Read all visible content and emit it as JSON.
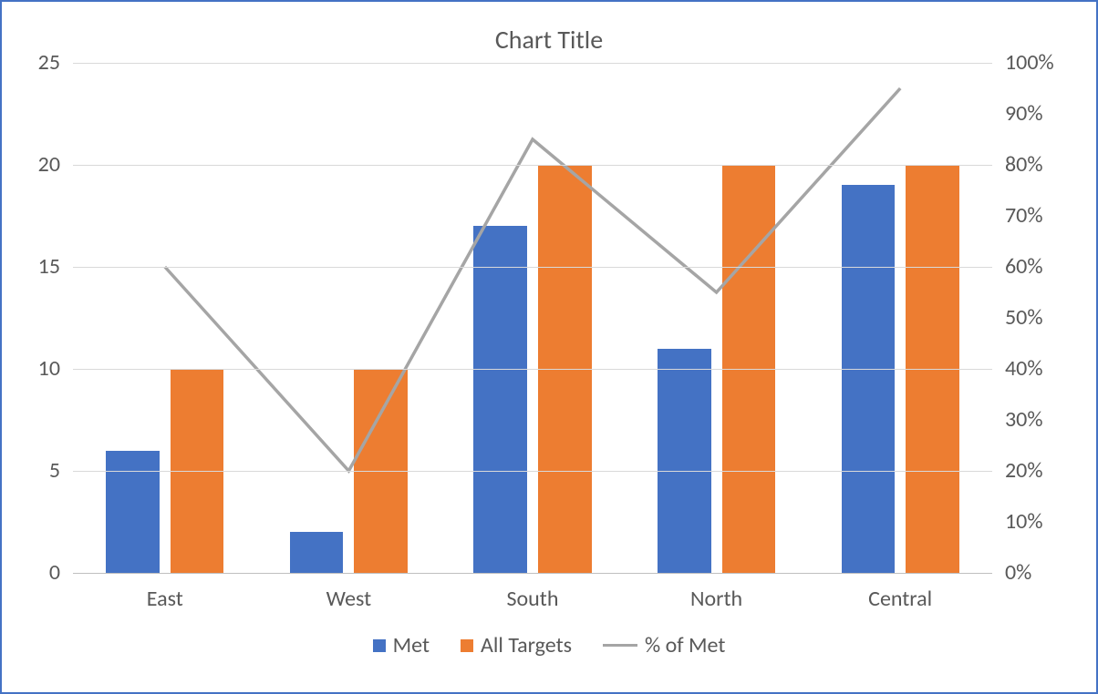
{
  "chart_data": {
    "type": "bar",
    "title": "Chart Title",
    "categories": [
      "East",
      "West",
      "South",
      "North",
      "Central"
    ],
    "series": [
      {
        "name": "Met",
        "kind": "bar",
        "axis": "primary",
        "color": "#4472C4",
        "values": [
          6,
          2,
          17,
          11,
          19
        ]
      },
      {
        "name": "All Targets",
        "kind": "bar",
        "axis": "primary",
        "color": "#ED7D31",
        "values": [
          10,
          10,
          20,
          20,
          20
        ]
      },
      {
        "name": "% of Met",
        "kind": "line",
        "axis": "secondary",
        "color": "#A5A5A5",
        "values": [
          0.6,
          0.2,
          0.85,
          0.55,
          0.95
        ]
      }
    ],
    "primary_axis": {
      "min": 0,
      "max": 25,
      "ticks": [
        0,
        5,
        10,
        15,
        20,
        25
      ]
    },
    "secondary_axis": {
      "min": 0,
      "max": 1.0,
      "format": "percent",
      "ticks": [
        0.0,
        0.1,
        0.2,
        0.3,
        0.4,
        0.5,
        0.6,
        0.7,
        0.8,
        0.9,
        1.0
      ],
      "tick_labels": [
        "0%",
        "10%",
        "20%",
        "30%",
        "40%",
        "50%",
        "60%",
        "70%",
        "80%",
        "90%",
        "100%"
      ]
    },
    "legend": [
      "Met",
      "All Targets",
      "% of Met"
    ]
  }
}
